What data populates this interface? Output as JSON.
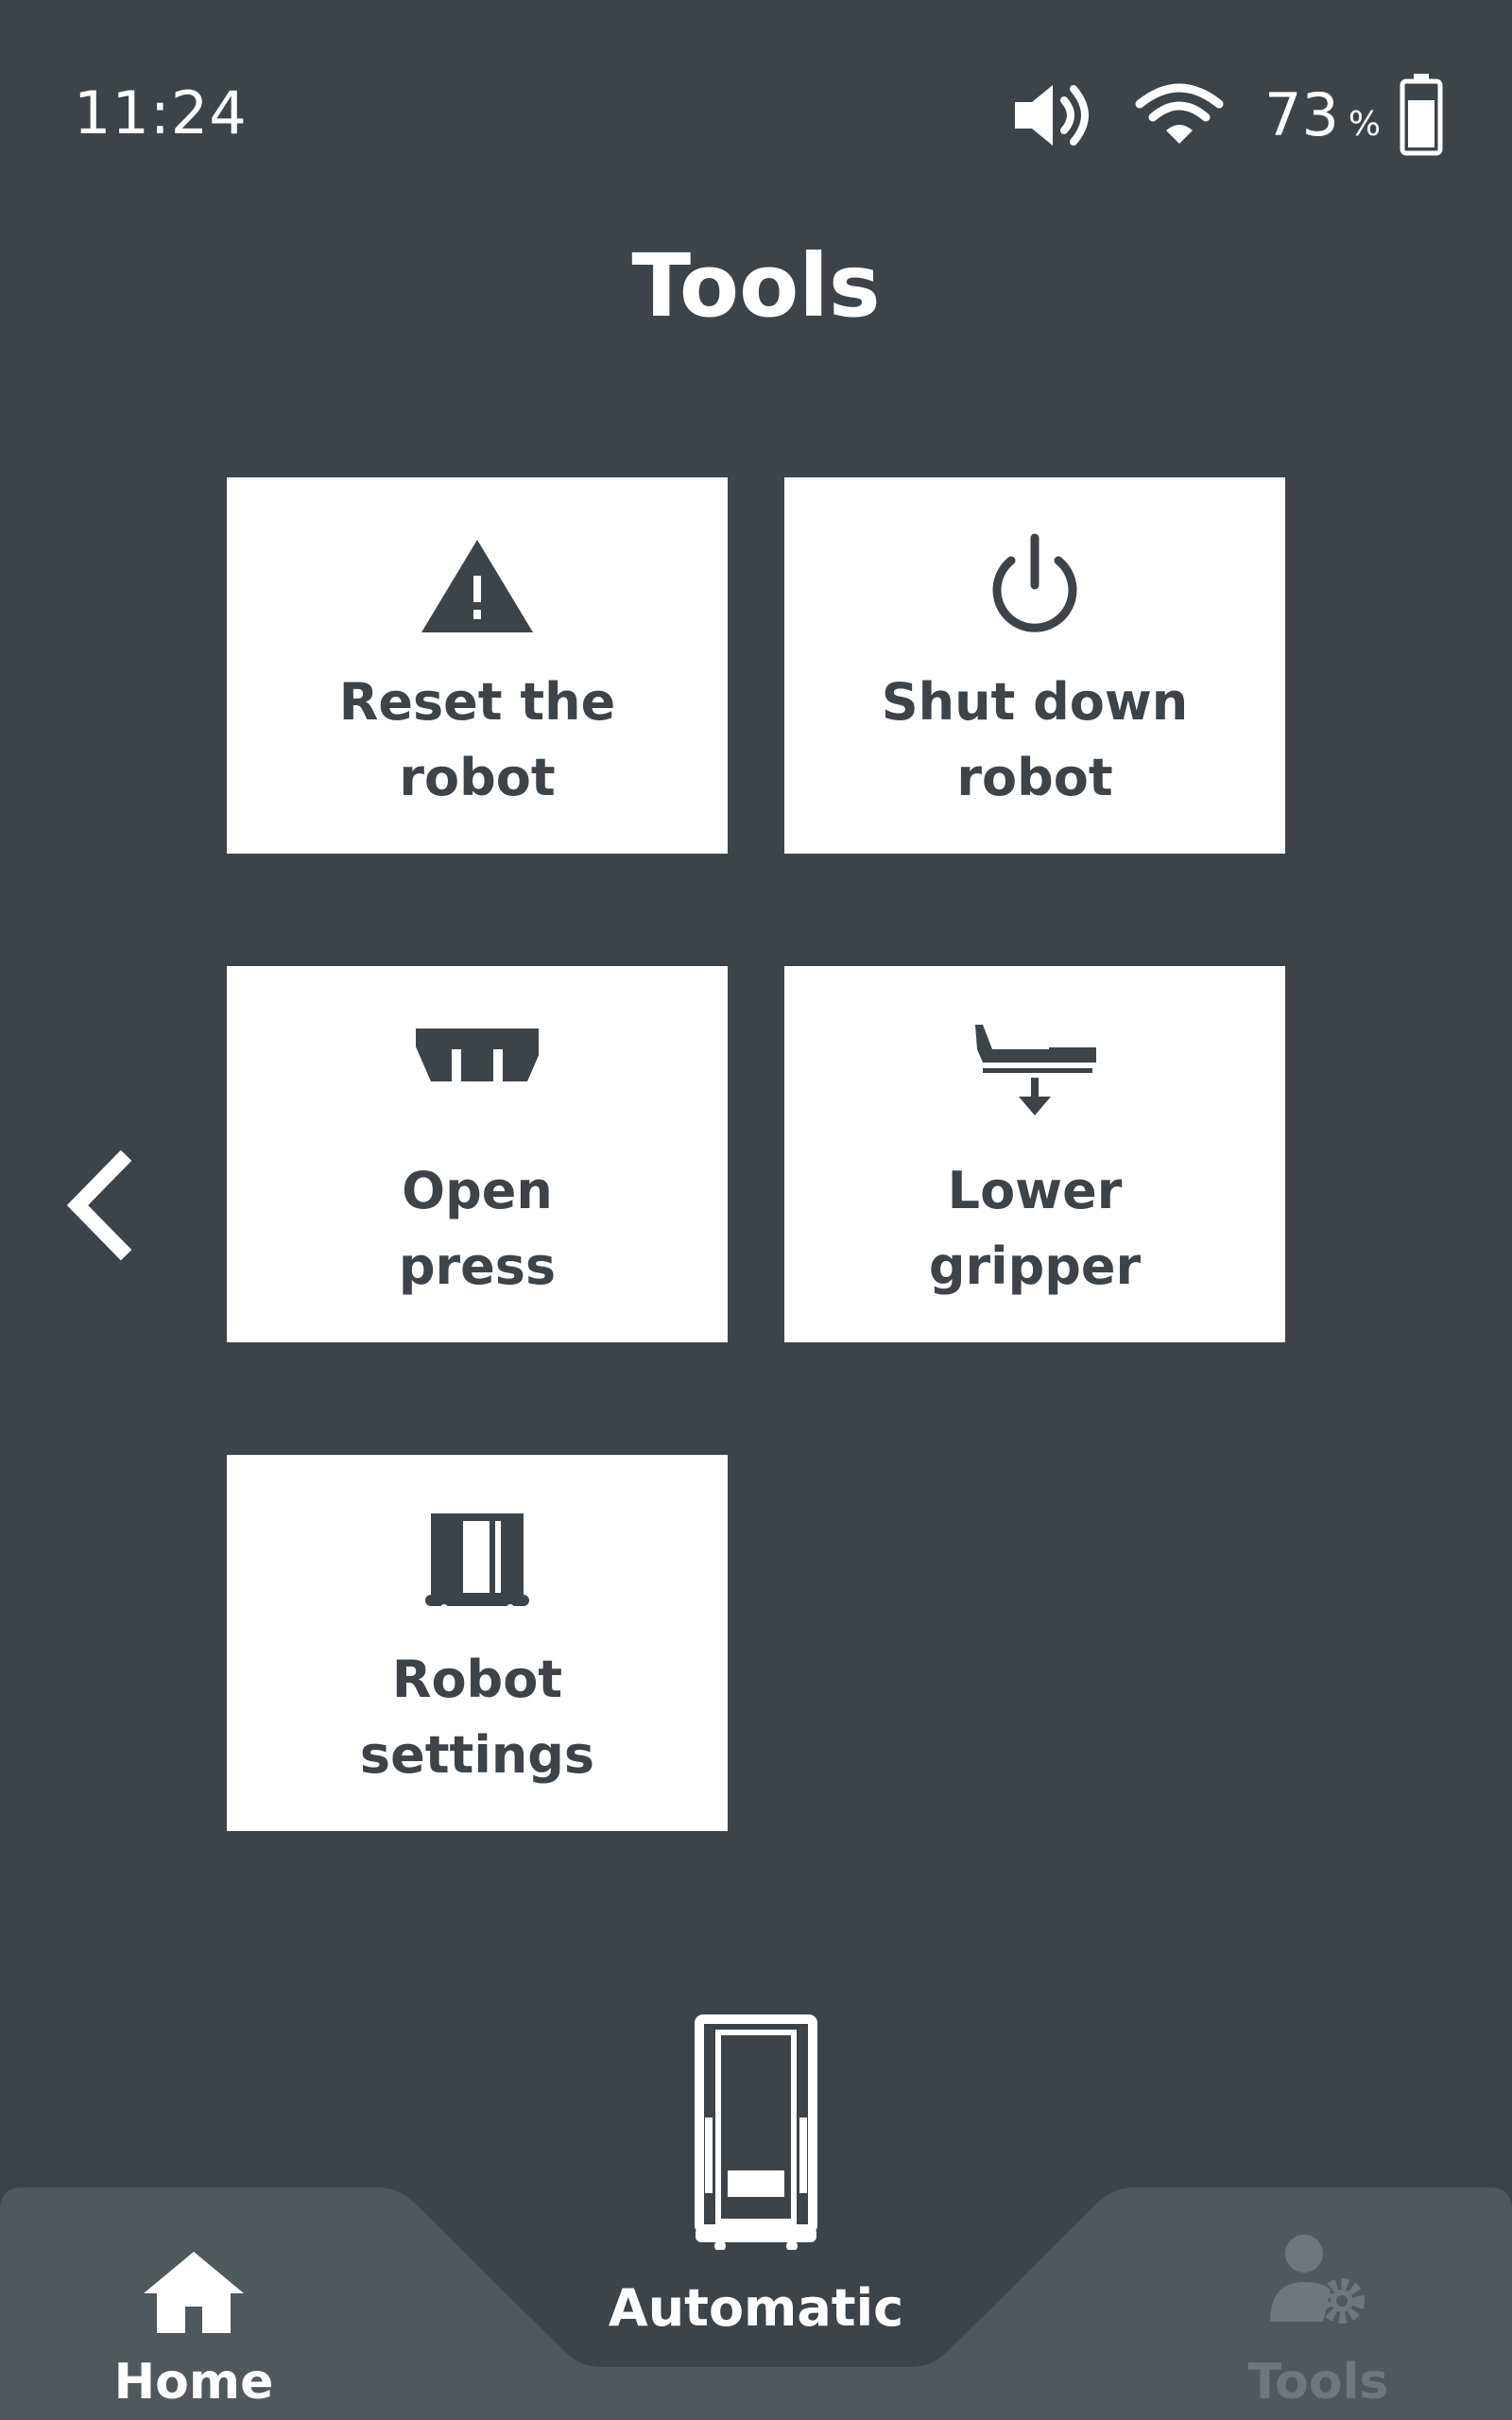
{
  "status_bar": {
    "time": "11:24",
    "battery_level": "73",
    "battery_unit": "%",
    "icons": [
      "volume-icon",
      "wifi-icon",
      "battery-icon"
    ]
  },
  "page": {
    "title": "Tools"
  },
  "tiles": [
    {
      "label": "Reset the\nrobot",
      "icon": "warning-icon"
    },
    {
      "label": "Shut down\nrobot",
      "icon": "power-icon"
    },
    {
      "label": "Open\npress",
      "icon": "press-icon"
    },
    {
      "label": "Lower\ngripper",
      "icon": "gripper-lower-icon"
    },
    {
      "label": "Robot\nsettings",
      "icon": "robot-settings-icon"
    }
  ],
  "bottom_nav": {
    "home": {
      "label": "Home",
      "icon": "home-icon"
    },
    "automatic": {
      "label": "Automatic",
      "icon": "robot-icon"
    },
    "tools": {
      "label": "Tools",
      "icon": "user-gear-icon"
    }
  },
  "colors": {
    "background": "#3c444a",
    "tile": "#ffffff",
    "tile_text": "#3c444a",
    "nav_background": "#4f585d",
    "inactive_nav": "#6e777d"
  }
}
